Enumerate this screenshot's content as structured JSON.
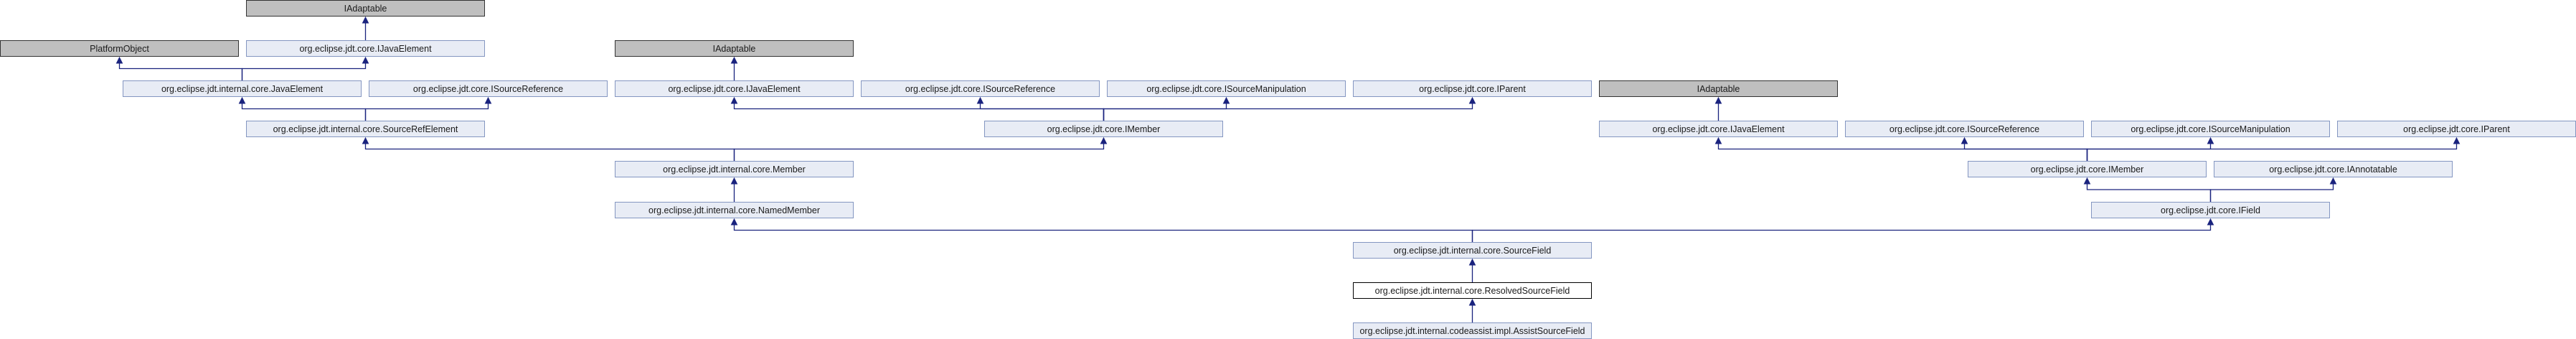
{
  "diagram": {
    "type": "class-inheritance-graph",
    "colors": {
      "node_fill": "#e8ecf5",
      "node_border": "#8496c1",
      "external_fill": "#bfbfbf",
      "current_fill": "#ffffff",
      "edge": "#1a237e"
    },
    "nodes": {
      "n_iadaptable_1": "IAdaptable",
      "n_platformobject": "PlatformObject",
      "n_ijavaelement_1": "org.eclipse.jdt.core.IJavaElement",
      "n_javaelement": "org.eclipse.jdt.internal.core.JavaElement",
      "n_isourcereference_1": "org.eclipse.jdt.core.ISourceReference",
      "n_sourcerefelement": "org.eclipse.jdt.internal.core.SourceRefElement",
      "n_iadaptable_2": "IAdaptable",
      "n_ijavaelement_2": "org.eclipse.jdt.core.IJavaElement",
      "n_isourcereference_2": "org.eclipse.jdt.core.ISourceReference",
      "n_isourcemanipulation_1": "org.eclipse.jdt.core.ISourceManipulation",
      "n_iparent_1": "org.eclipse.jdt.core.IParent",
      "n_imember_1": "org.eclipse.jdt.core.IMember",
      "n_member": "org.eclipse.jdt.internal.core.Member",
      "n_namedmember": "org.eclipse.jdt.internal.core.NamedMember",
      "n_iadaptable_3": "IAdaptable",
      "n_ijavaelement_3": "org.eclipse.jdt.core.IJavaElement",
      "n_isourcereference_3": "org.eclipse.jdt.core.ISourceReference",
      "n_isourcemanipulation_2": "org.eclipse.jdt.core.ISourceManipulation",
      "n_iparent_2": "org.eclipse.jdt.core.IParent",
      "n_imember_2": "org.eclipse.jdt.core.IMember",
      "n_iannotatable": "org.eclipse.jdt.core.IAnnotatable",
      "n_ifield": "org.eclipse.jdt.core.IField",
      "n_sourcefield": "org.eclipse.jdt.internal.core.SourceField",
      "n_resolvedsourcefield": "org.eclipse.jdt.internal.core.ResolvedSourceField",
      "n_assistsourcefield": "org.eclipse.jdt.internal.codeassist.impl.AssistSourceField"
    },
    "edges": [
      [
        "n_ijavaelement_1",
        "n_iadaptable_1"
      ],
      [
        "n_javaelement",
        "n_platformobject"
      ],
      [
        "n_javaelement",
        "n_ijavaelement_1"
      ],
      [
        "n_sourcerefelement",
        "n_javaelement"
      ],
      [
        "n_sourcerefelement",
        "n_isourcereference_1"
      ],
      [
        "n_ijavaelement_2",
        "n_iadaptable_2"
      ],
      [
        "n_imember_1",
        "n_ijavaelement_2"
      ],
      [
        "n_imember_1",
        "n_isourcereference_2"
      ],
      [
        "n_imember_1",
        "n_isourcemanipulation_1"
      ],
      [
        "n_imember_1",
        "n_iparent_1"
      ],
      [
        "n_member",
        "n_sourcerefelement"
      ],
      [
        "n_member",
        "n_imember_1"
      ],
      [
        "n_namedmember",
        "n_member"
      ],
      [
        "n_ijavaelement_3",
        "n_iadaptable_3"
      ],
      [
        "n_imember_2",
        "n_ijavaelement_3"
      ],
      [
        "n_imember_2",
        "n_isourcereference_3"
      ],
      [
        "n_imember_2",
        "n_isourcemanipulation_2"
      ],
      [
        "n_imember_2",
        "n_iparent_2"
      ],
      [
        "n_ifield",
        "n_imember_2"
      ],
      [
        "n_ifield",
        "n_iannotatable"
      ],
      [
        "n_sourcefield",
        "n_namedmember"
      ],
      [
        "n_sourcefield",
        "n_ifield"
      ],
      [
        "n_resolvedsourcefield",
        "n_sourcefield"
      ],
      [
        "n_assistsourcefield",
        "n_resolvedsourcefield"
      ]
    ]
  }
}
